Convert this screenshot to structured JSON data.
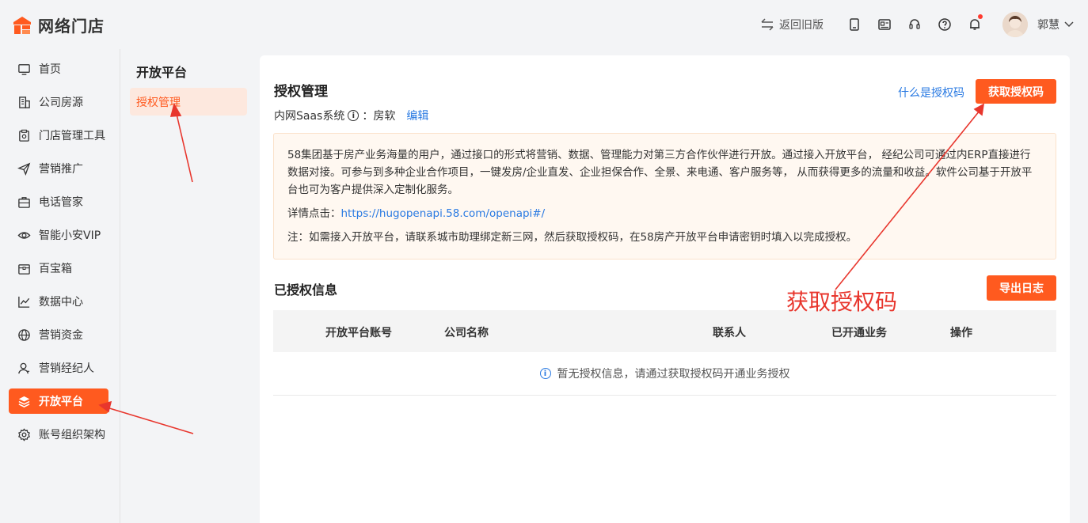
{
  "brand": {
    "name": "网络门店",
    "accent": "#ff5a1f"
  },
  "header": {
    "back_old": "返回旧版",
    "icons": [
      "tablet-icon",
      "id-card-icon",
      "headset-icon",
      "help-icon",
      "bell-icon"
    ],
    "user_name": "郭慧"
  },
  "sidebar": {
    "items": [
      {
        "label": "首页",
        "icon": "monitor-icon"
      },
      {
        "label": "公司房源",
        "icon": "building-icon"
      },
      {
        "label": "门店管理工具",
        "icon": "clipboard-icon"
      },
      {
        "label": "营销推广",
        "icon": "send-icon"
      },
      {
        "label": "电话管家",
        "icon": "briefcase-icon"
      },
      {
        "label": "智能小安VIP",
        "icon": "eye-icon"
      },
      {
        "label": "百宝箱",
        "icon": "box-icon"
      },
      {
        "label": "数据中心",
        "icon": "chart-icon"
      },
      {
        "label": "营销资金",
        "icon": "globe-icon"
      },
      {
        "label": "营销经纪人",
        "icon": "person-icon"
      },
      {
        "label": "开放平台",
        "icon": "layers-icon",
        "active": true
      },
      {
        "label": "账号组织架构",
        "icon": "gear-icon"
      }
    ]
  },
  "subnav": {
    "title": "开放平台",
    "active_item": "授权管理"
  },
  "main": {
    "title": "授权管理",
    "what_link": "什么是授权码",
    "get_code_button": "获取授权码",
    "system_label": "内网Saas系统",
    "system_value": "：房软",
    "edit_link": "编辑",
    "notice": {
      "paragraph": "58集团基于房产业务海量的用户，通过接口的形式将营销、数据、管理能力对第三方合作伙伴进行开放。通过接入开放平台， 经纪公司可通过内ERP直接进行数据对接。可参与到多种企业合作项目，一键发房/企业直发、企业担保合作、全景、来电通、客户服务等， 从而获得更多的流量和收益。软件公司基于开放平台也可为客户提供深入定制化服务。",
      "detail_label": "详情点击：",
      "detail_link": "https://hugopenapi.58.com/openapi#/",
      "note": "注：如需接入开放平台，请联系城市助理绑定新三网，然后获取授权码，在58房产开放平台申请密钥时填入以完成授权。"
    },
    "authorized_section": {
      "title": "已授权信息",
      "export_button": "导出日志",
      "columns": [
        "开放平台账号",
        "公司名称",
        "联系人",
        "已开通业务",
        "操作"
      ],
      "empty_text": "暂无授权信息，请通过获取授权码开通业务授权"
    }
  },
  "annotation": {
    "text": "获取授权码",
    "color": "#e8362d"
  }
}
